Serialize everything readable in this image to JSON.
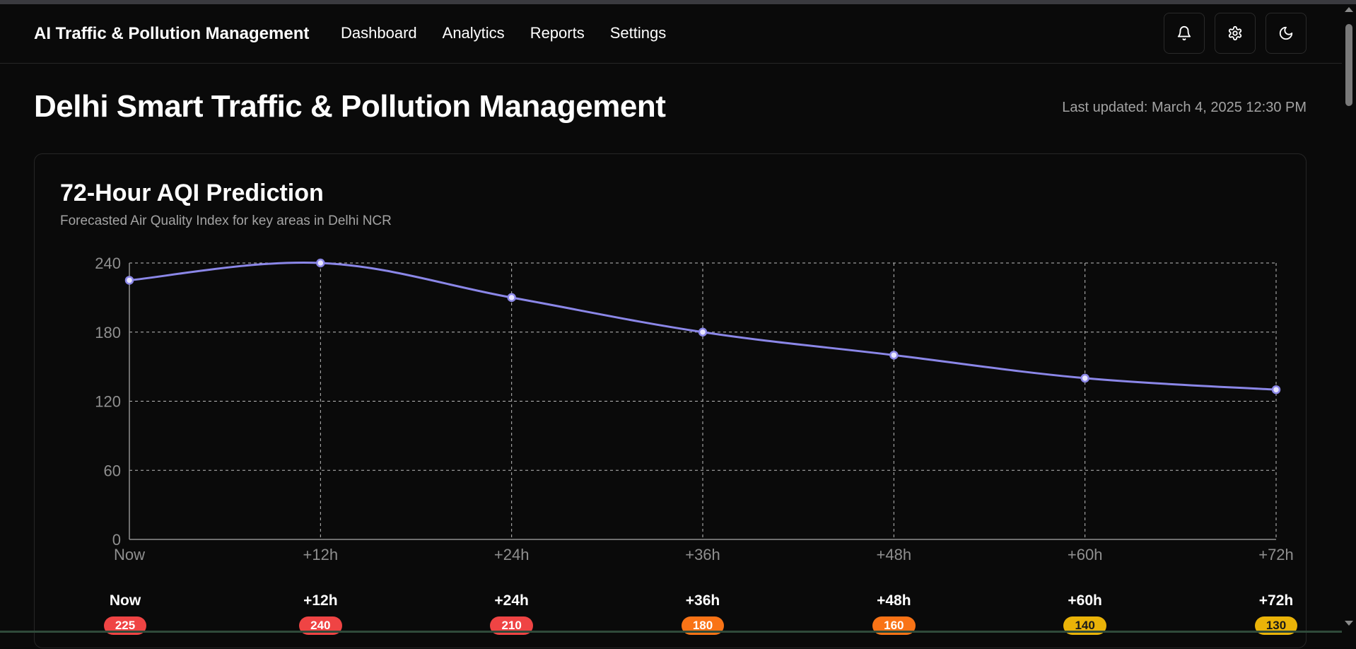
{
  "app": {
    "brand": "AI Traffic & Pollution Management",
    "nav": [
      {
        "label": "Dashboard"
      },
      {
        "label": "Analytics"
      },
      {
        "label": "Reports"
      },
      {
        "label": "Settings"
      }
    ],
    "actions": [
      "bell-icon",
      "gear-icon",
      "moon-icon"
    ]
  },
  "page": {
    "title": "Delhi Smart Traffic & Pollution Management",
    "last_updated": "Last updated: March 4, 2025 12:30 PM"
  },
  "card": {
    "title": "72-Hour AQI Prediction",
    "subtitle": "Forecasted Air Quality Index for key areas in Delhi NCR"
  },
  "colors": {
    "line": "#8b87e8",
    "red": "#ef4444",
    "orange": "#f97316",
    "yellow": "#eab308"
  },
  "forecast": [
    {
      "label": "Now",
      "value": "225",
      "color": "red"
    },
    {
      "label": "+12h",
      "value": "240",
      "color": "red"
    },
    {
      "label": "+24h",
      "value": "210",
      "color": "red"
    },
    {
      "label": "+36h",
      "value": "180",
      "color": "orange"
    },
    {
      "label": "+48h",
      "value": "160",
      "color": "orange"
    },
    {
      "label": "+60h",
      "value": "140",
      "color": "yellow"
    },
    {
      "label": "+72h",
      "value": "130",
      "color": "yellow"
    }
  ],
  "chart_data": {
    "type": "line",
    "categories": [
      "Now",
      "+12h",
      "+24h",
      "+36h",
      "+48h",
      "+60h",
      "+72h"
    ],
    "series": [
      {
        "values": [
          225,
          240,
          210,
          180,
          160,
          140,
          130
        ]
      }
    ],
    "yticks": [
      0,
      60,
      120,
      180,
      240
    ],
    "ylim": [
      0,
      240
    ],
    "grid": true,
    "title": "72-Hour AQI Prediction"
  }
}
